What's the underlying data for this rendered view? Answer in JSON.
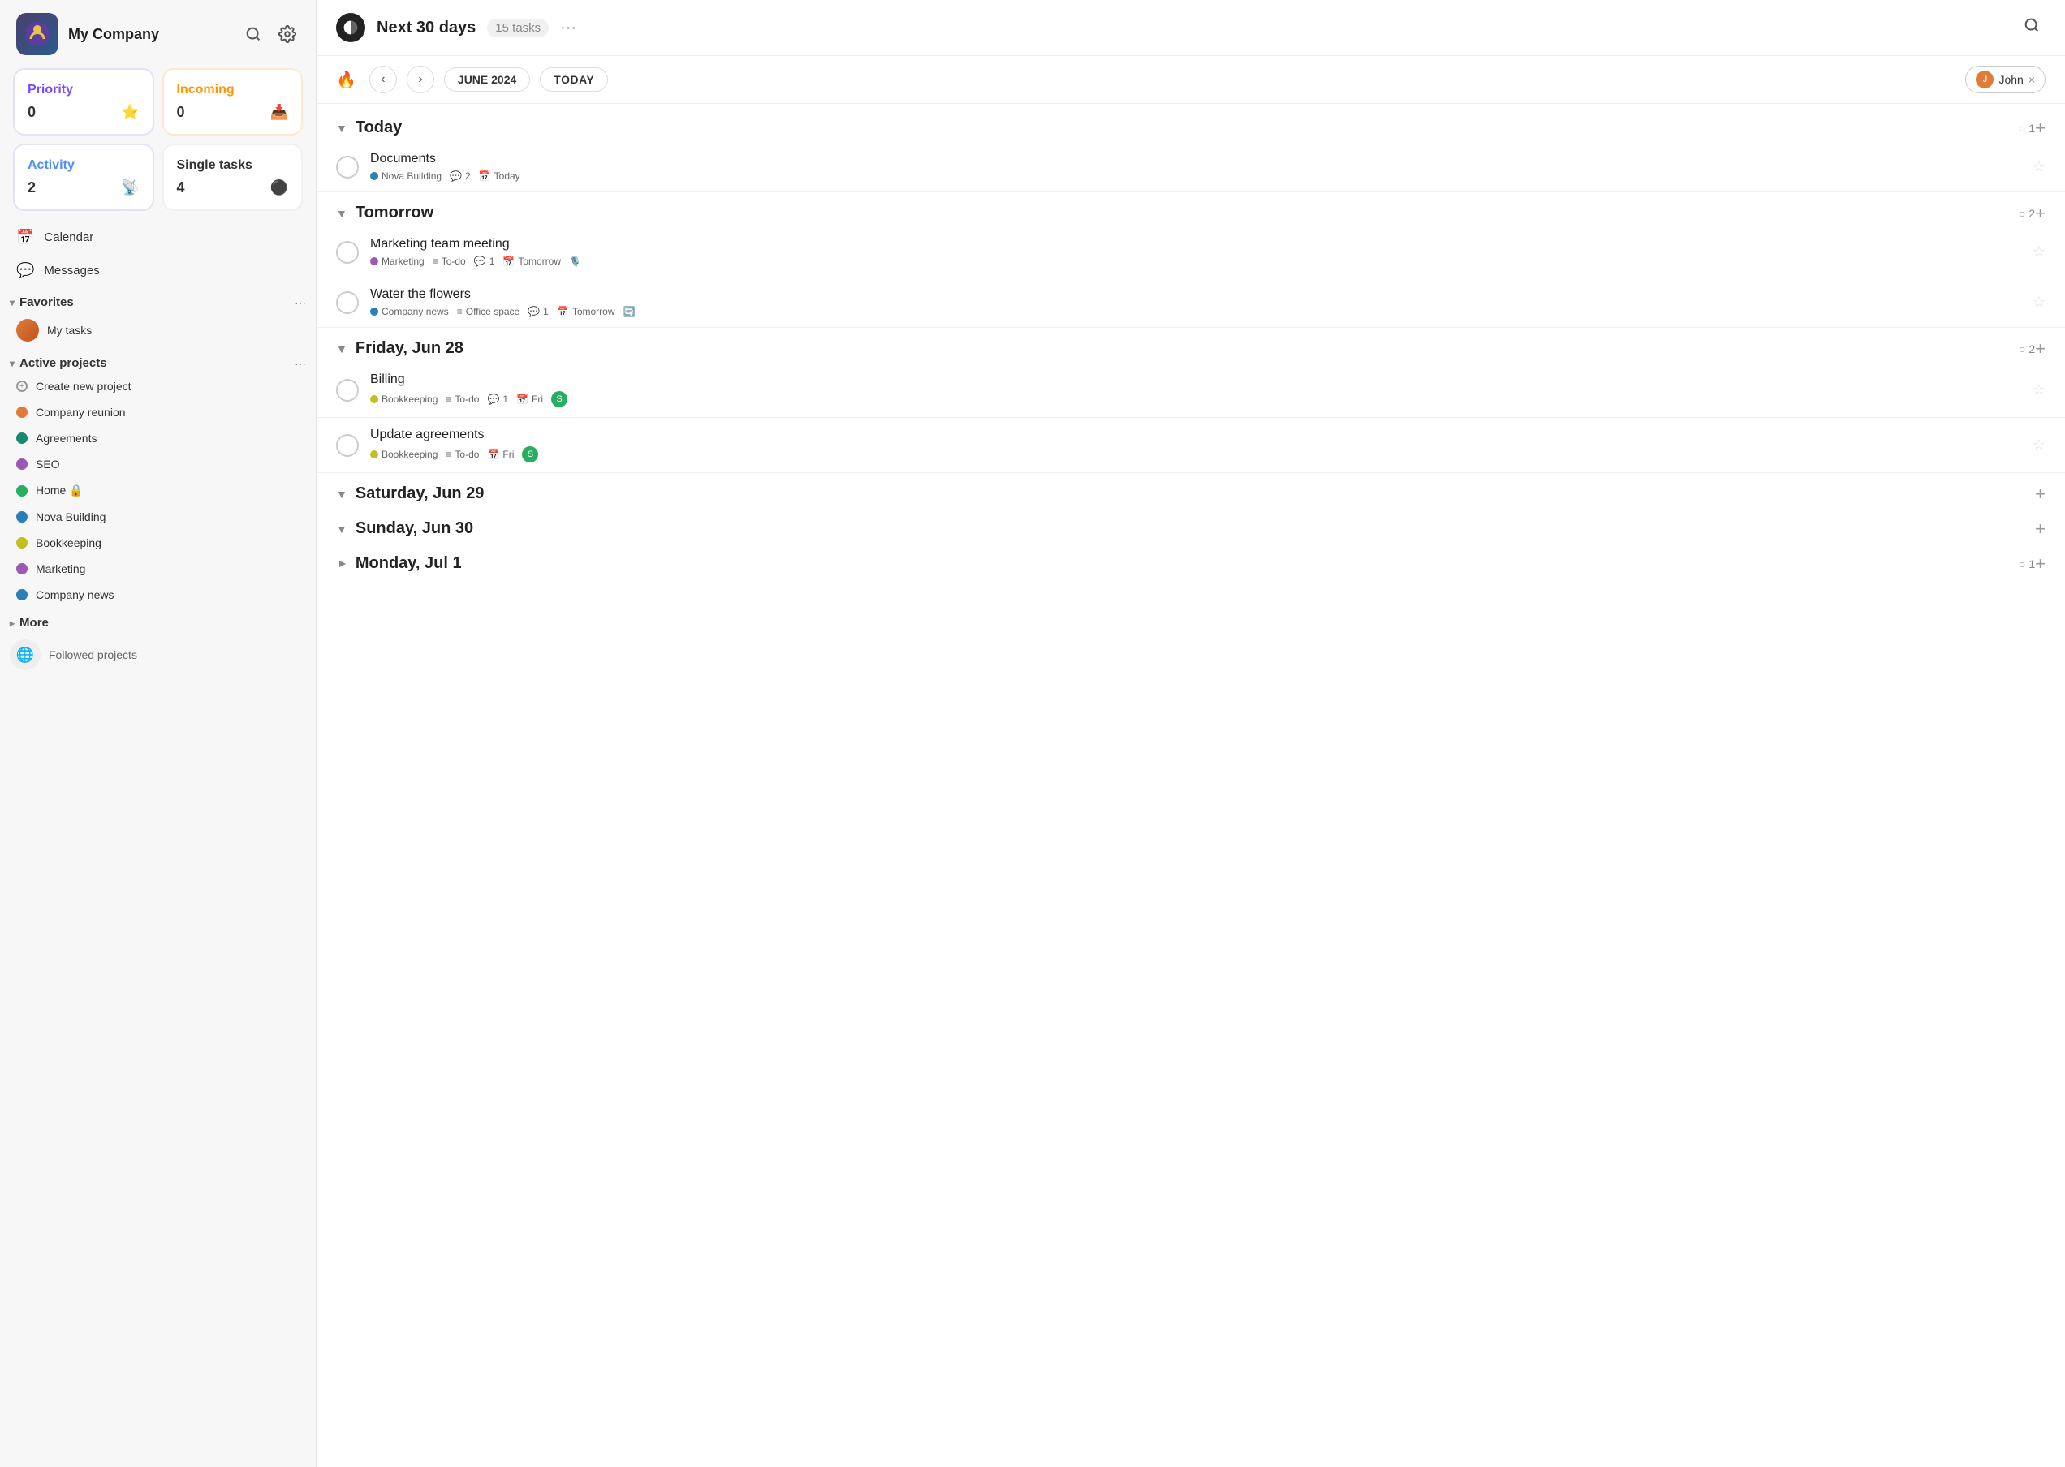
{
  "sidebar": {
    "company_name": "My Company",
    "stats": {
      "priority": {
        "label": "Priority",
        "count": "0",
        "icon": "⭐"
      },
      "incoming": {
        "label": "Incoming",
        "count": "0",
        "icon": "📥"
      },
      "activity": {
        "label": "Activity",
        "count": "2",
        "icon": "📡"
      },
      "single": {
        "label": "Single tasks",
        "count": "4",
        "icon": "⚫"
      }
    },
    "nav": [
      {
        "id": "calendar",
        "label": "Calendar",
        "icon": "📅"
      },
      {
        "id": "messages",
        "label": "Messages",
        "icon": "💬"
      }
    ],
    "favorites": {
      "label": "Favorites",
      "items": [
        {
          "id": "my-tasks",
          "label": "My tasks",
          "color": "#e07b39"
        }
      ]
    },
    "active_projects": {
      "label": "Active projects",
      "items": [
        {
          "id": "create-new",
          "label": "Create new project",
          "color": null,
          "icon": "+"
        },
        {
          "id": "company-reunion",
          "label": "Company reunion",
          "color": "#e07b39"
        },
        {
          "id": "agreements",
          "label": "Agreements",
          "color": "#1a8a6e"
        },
        {
          "id": "seo",
          "label": "SEO",
          "color": "#9b59b6"
        },
        {
          "id": "home",
          "label": "Home 🔒",
          "color": "#27ae60"
        },
        {
          "id": "nova-building",
          "label": "Nova Building",
          "color": "#2980b9"
        },
        {
          "id": "bookkeeping",
          "label": "Bookkeeping",
          "color": "#c0c020"
        },
        {
          "id": "marketing",
          "label": "Marketing",
          "color": "#9b59b6"
        },
        {
          "id": "company-news",
          "label": "Company news",
          "color": "#2980b9"
        }
      ]
    },
    "more": {
      "label": "More"
    },
    "followed_projects": {
      "label": "Followed projects"
    }
  },
  "main": {
    "header": {
      "view_label": "Next 30 days",
      "task_count": "15 tasks",
      "more_icon": "···",
      "search_icon": "🔍"
    },
    "toolbar": {
      "date_label": "JUNE 2024",
      "fire_icon": "🔥",
      "prev_icon": "‹",
      "next_icon": "›",
      "today_label": "TODAY",
      "filter_user": "John",
      "filter_remove": "×"
    },
    "groups": [
      {
        "id": "today",
        "title": "Today",
        "count": "1",
        "collapsed": false,
        "tasks": [
          {
            "id": "documents",
            "title": "Documents",
            "project": "Nova Building",
            "project_color": "#2980b9",
            "meta": [
              {
                "type": "comment",
                "icon": "💬",
                "value": "2"
              },
              {
                "type": "date",
                "icon": "📅",
                "value": "Today"
              }
            ]
          }
        ]
      },
      {
        "id": "tomorrow",
        "title": "Tomorrow",
        "count": "2",
        "collapsed": false,
        "tasks": [
          {
            "id": "marketing-meeting",
            "title": "Marketing team meeting",
            "project": "Marketing",
            "project_color": "#9b59b6",
            "meta": [
              {
                "type": "tag",
                "icon": "≡",
                "value": "To-do"
              },
              {
                "type": "comment",
                "icon": "💬",
                "value": "1"
              },
              {
                "type": "date",
                "icon": "📅",
                "value": "Tomorrow"
              },
              {
                "type": "mic",
                "icon": "🎙️",
                "value": ""
              }
            ]
          },
          {
            "id": "water-flowers",
            "title": "Water the flowers",
            "project": "Company news",
            "project_color": "#2980b9",
            "meta": [
              {
                "type": "tag",
                "icon": "≡",
                "value": "Office space"
              },
              {
                "type": "comment",
                "icon": "💬",
                "value": "1"
              },
              {
                "type": "date",
                "icon": "📅",
                "value": "Tomorrow"
              },
              {
                "type": "refresh",
                "icon": "🔄",
                "value": ""
              }
            ]
          }
        ]
      },
      {
        "id": "friday-jun28",
        "title": "Friday, Jun 28",
        "count": "2",
        "collapsed": false,
        "tasks": [
          {
            "id": "billing",
            "title": "Billing",
            "project": "Bookkeeping",
            "project_color": "#c0c020",
            "meta": [
              {
                "type": "tag",
                "icon": "≡",
                "value": "To-do"
              },
              {
                "type": "comment",
                "icon": "💬",
                "value": "1"
              },
              {
                "type": "date",
                "icon": "📅",
                "value": "Fri"
              },
              {
                "type": "avatar",
                "icon": "S",
                "value": ""
              }
            ]
          },
          {
            "id": "update-agreements",
            "title": "Update agreements",
            "project": "Bookkeeping",
            "project_color": "#c0c020",
            "meta": [
              {
                "type": "tag",
                "icon": "≡",
                "value": "To-do"
              },
              {
                "type": "date",
                "icon": "📅",
                "value": "Fri"
              },
              {
                "type": "avatar",
                "icon": "S",
                "value": ""
              }
            ]
          }
        ]
      },
      {
        "id": "saturday-jun29",
        "title": "Saturday, Jun 29",
        "count": "",
        "collapsed": false,
        "tasks": []
      },
      {
        "id": "sunday-jun30",
        "title": "Sunday, Jun 30",
        "count": "",
        "collapsed": false,
        "tasks": []
      },
      {
        "id": "monday-jul1",
        "title": "Monday, Jul 1",
        "count": "1",
        "collapsed": true,
        "tasks": []
      }
    ]
  },
  "icons": {
    "search": "🔍",
    "settings": "⚙️",
    "calendar": "📅",
    "messages": "💬",
    "chevron_down": "▾",
    "chevron_right": "▸",
    "more": "···",
    "star": "☆",
    "add": "+",
    "fire": "🔥",
    "globe": "🌐",
    "feed": "📡"
  },
  "colors": {
    "priority_label": "#7c4dff",
    "incoming_label": "#ff9500",
    "activity_label": "#4f8ef7",
    "single_label": "#333",
    "priority_bg": "#f5f0ff",
    "incoming_bg": "#fff8f0"
  }
}
